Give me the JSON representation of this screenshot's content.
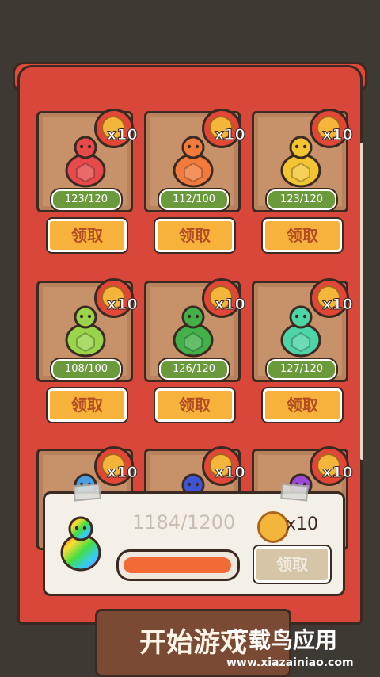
{
  "collections": [
    {
      "row": 0,
      "col": 0,
      "count": "123/120",
      "reward": "x10",
      "color": "#e64a4a",
      "claim": "领取"
    },
    {
      "row": 0,
      "col": 1,
      "count": "112/100",
      "reward": "x10",
      "color": "#f27a3b",
      "claim": "领取"
    },
    {
      "row": 0,
      "col": 2,
      "count": "123/120",
      "reward": "x10",
      "color": "#f3c532",
      "claim": "领取"
    },
    {
      "row": 1,
      "col": 0,
      "count": "108/100",
      "reward": "x10",
      "color": "#99d44a",
      "claim": "领取"
    },
    {
      "row": 1,
      "col": 1,
      "count": "126/120",
      "reward": "x10",
      "color": "#42b14a",
      "claim": "领取"
    },
    {
      "row": 1,
      "col": 2,
      "count": "127/120",
      "reward": "x10",
      "color": "#4ed5a7",
      "claim": "领取"
    },
    {
      "row": 2,
      "col": 0,
      "count": "",
      "reward": "x10",
      "color": "#4a9de0",
      "claim": ""
    },
    {
      "row": 2,
      "col": 1,
      "count": "",
      "reward": "x10",
      "color": "#3f55d8",
      "claim": ""
    },
    {
      "row": 2,
      "col": 2,
      "count": "",
      "reward": "x10",
      "color": "#9b4ad8",
      "claim": ""
    }
  ],
  "bottom_panel": {
    "count": "1184/1200",
    "reward": "x10",
    "progress": 0.9867,
    "claim": "领取"
  },
  "start_button": "开始游戏",
  "watermark": {
    "title": "下载鸟应用",
    "url": "www.xiazainiao.com"
  }
}
